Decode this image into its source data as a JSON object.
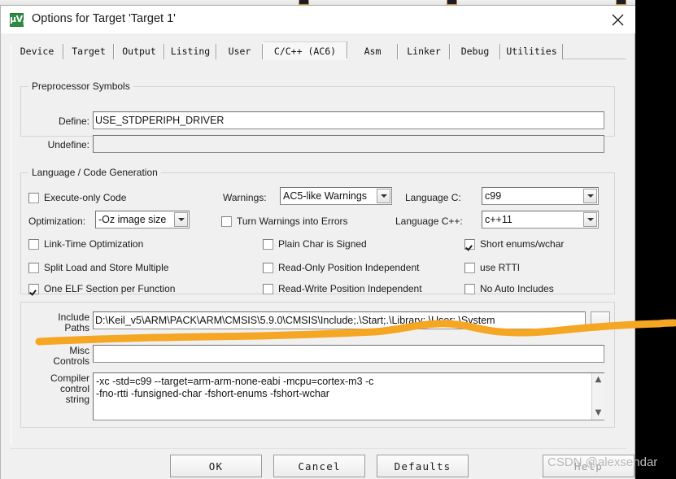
{
  "window": {
    "title": "Options for Target 'Target 1'",
    "icon": "keil-uvision5-icon",
    "close_label": "close-icon"
  },
  "background_toolbar": {
    "icons": [
      "build-icon",
      "rebuild-icon",
      "batch-build-icon",
      "stop-build-icon",
      "target-options-icon",
      "manage-project-icon"
    ]
  },
  "tabs": [
    {
      "label": "Device",
      "active": false
    },
    {
      "label": "Target",
      "active": false
    },
    {
      "label": "Output",
      "active": false
    },
    {
      "label": "Listing",
      "active": false
    },
    {
      "label": "User",
      "active": false
    },
    {
      "label": "C/C++ (AC6)",
      "active": true
    },
    {
      "label": "Asm",
      "active": false
    },
    {
      "label": "Linker",
      "active": false
    },
    {
      "label": "Debug",
      "active": false
    },
    {
      "label": "Utilities",
      "active": false
    }
  ],
  "preprocessor": {
    "group_label": "Preprocessor Symbols",
    "define_label": "Define:",
    "define_value": "USE_STDPERIPH_DRIVER",
    "undefine_label": "Undefine:",
    "undefine_value": ""
  },
  "language": {
    "group_label": "Language / Code Generation",
    "execute_only_code": {
      "label": "Execute-only Code",
      "checked": false
    },
    "optimization_label": "Optimization:",
    "optimization_value": "-Oz image size",
    "link_time_optimization": {
      "label": "Link-Time Optimization",
      "checked": false
    },
    "split_load_store": {
      "label": "Split Load and Store Multiple",
      "checked": false
    },
    "one_elf_section": {
      "label": "One ELF Section per Function",
      "checked": true
    },
    "warnings_label": "Warnings:",
    "warnings_value": "AC5-like Warnings",
    "turn_warnings_into_errors": {
      "label": "Turn Warnings into Errors",
      "checked": false
    },
    "plain_char_is_signed": {
      "label": "Plain Char is Signed",
      "checked": false
    },
    "read_only_position_independent": {
      "label": "Read-Only Position Independent",
      "checked": false
    },
    "read_write_position_independent": {
      "label": "Read-Write Position Independent",
      "checked": false
    },
    "language_c_label": "Language C:",
    "language_c_value": "c99",
    "language_cpp_label": "Language C++:",
    "language_cpp_value": "c++11",
    "short_enums_wchar": {
      "label": "Short enums/wchar",
      "checked": true
    },
    "use_rtti": {
      "label": "use RTTI",
      "checked": false
    },
    "no_auto_includes": {
      "label": "No Auto Includes",
      "checked": false
    }
  },
  "paths": {
    "include_label_line1": "Include",
    "include_label_line2": "Paths",
    "include_value": "D:\\Keil_v5\\ARM\\PACK\\ARM\\CMSIS\\5.9.0\\CMSIS\\Include;.\\Start;.\\Library;.\\User;.\\System",
    "browse_label": "...",
    "misc_label_line1": "Misc",
    "misc_label_line2": "Controls",
    "misc_value": "",
    "compiler_label_line1": "Compiler",
    "compiler_label_line2": "control",
    "compiler_label_line3": "string",
    "compiler_value": "-xc -std=c99 --target=arm-arm-none-eabi -mcpu=cortex-m3 -c\n-fno-rtti -funsigned-char -fshort-enums -fshort-wchar",
    "scroll_up": "▲",
    "scroll_down": "▼"
  },
  "buttons": {
    "ok": "OK",
    "cancel": "Cancel",
    "defaults": "Defaults",
    "help": "Help"
  },
  "annotation": {
    "type": "orange-highlight-stroke",
    "color": "#F5A623",
    "target": "include-paths-row"
  },
  "watermark": {
    "text": "CSDN @alexsendar"
  }
}
